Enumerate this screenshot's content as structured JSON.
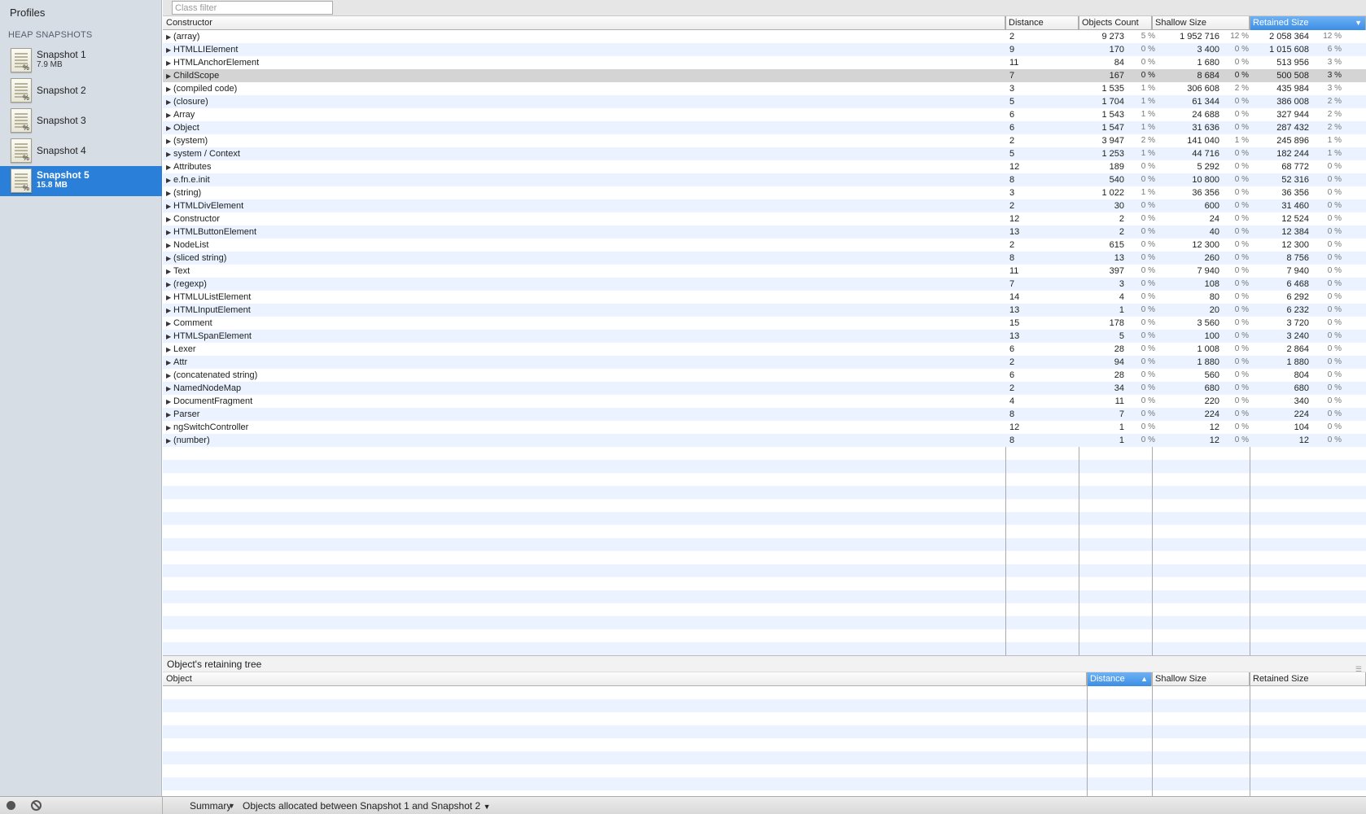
{
  "sidebar": {
    "title": "Profiles",
    "section": "HEAP SNAPSHOTS",
    "snapshots": [
      {
        "name": "Snapshot 1",
        "size": "7.9 MB"
      },
      {
        "name": "Snapshot 2",
        "size": ""
      },
      {
        "name": "Snapshot 3",
        "size": ""
      },
      {
        "name": "Snapshot 4",
        "size": ""
      },
      {
        "name": "Snapshot 5",
        "size": "15.8 MB",
        "selected": true
      }
    ]
  },
  "filter": {
    "placeholder": "Class filter"
  },
  "columns": {
    "constructor": "Constructor",
    "distance": "Distance",
    "objects_count": "Objects Count",
    "shallow_size": "Shallow Size",
    "retained_size": "Retained Size",
    "sort_arrow": "▼"
  },
  "rows": [
    {
      "name": "(array)",
      "distance": "2",
      "count": "9 273",
      "count_pct": "5 %",
      "shallow": "1 952 716",
      "shallow_pct": "12 %",
      "retained": "2 058 364",
      "retained_pct": "12 %"
    },
    {
      "name": "HTMLLIElement",
      "distance": "9",
      "count": "170",
      "count_pct": "0 %",
      "shallow": "3 400",
      "shallow_pct": "0 %",
      "retained": "1 015 608",
      "retained_pct": "6 %"
    },
    {
      "name": "HTMLAnchorElement",
      "distance": "11",
      "count": "84",
      "count_pct": "0 %",
      "shallow": "1 680",
      "shallow_pct": "0 %",
      "retained": "513 956",
      "retained_pct": "3 %"
    },
    {
      "name": "ChildScope",
      "distance": "7",
      "count": "167",
      "count_pct": "0 %",
      "shallow": "8 684",
      "shallow_pct": "0 %",
      "retained": "500 508",
      "retained_pct": "3 %",
      "highlight": true
    },
    {
      "name": "(compiled code)",
      "distance": "3",
      "count": "1 535",
      "count_pct": "1 %",
      "shallow": "306 608",
      "shallow_pct": "2 %",
      "retained": "435 984",
      "retained_pct": "3 %"
    },
    {
      "name": "(closure)",
      "distance": "5",
      "count": "1 704",
      "count_pct": "1 %",
      "shallow": "61 344",
      "shallow_pct": "0 %",
      "retained": "386 008",
      "retained_pct": "2 %"
    },
    {
      "name": "Array",
      "distance": "6",
      "count": "1 543",
      "count_pct": "1 %",
      "shallow": "24 688",
      "shallow_pct": "0 %",
      "retained": "327 944",
      "retained_pct": "2 %"
    },
    {
      "name": "Object",
      "distance": "6",
      "count": "1 547",
      "count_pct": "1 %",
      "shallow": "31 636",
      "shallow_pct": "0 %",
      "retained": "287 432",
      "retained_pct": "2 %"
    },
    {
      "name": "(system)",
      "distance": "2",
      "count": "3 947",
      "count_pct": "2 %",
      "shallow": "141 040",
      "shallow_pct": "1 %",
      "retained": "245 896",
      "retained_pct": "1 %"
    },
    {
      "name": "system / Context",
      "distance": "5",
      "count": "1 253",
      "count_pct": "1 %",
      "shallow": "44 716",
      "shallow_pct": "0 %",
      "retained": "182 244",
      "retained_pct": "1 %"
    },
    {
      "name": "Attributes",
      "distance": "12",
      "count": "189",
      "count_pct": "0 %",
      "shallow": "5 292",
      "shallow_pct": "0 %",
      "retained": "68 772",
      "retained_pct": "0 %"
    },
    {
      "name": "e.fn.e.init",
      "distance": "8",
      "count": "540",
      "count_pct": "0 %",
      "shallow": "10 800",
      "shallow_pct": "0 %",
      "retained": "52 316",
      "retained_pct": "0 %"
    },
    {
      "name": "(string)",
      "distance": "3",
      "count": "1 022",
      "count_pct": "1 %",
      "shallow": "36 356",
      "shallow_pct": "0 %",
      "retained": "36 356",
      "retained_pct": "0 %"
    },
    {
      "name": "HTMLDivElement",
      "distance": "2",
      "count": "30",
      "count_pct": "0 %",
      "shallow": "600",
      "shallow_pct": "0 %",
      "retained": "31 460",
      "retained_pct": "0 %"
    },
    {
      "name": "Constructor",
      "distance": "12",
      "count": "2",
      "count_pct": "0 %",
      "shallow": "24",
      "shallow_pct": "0 %",
      "retained": "12 524",
      "retained_pct": "0 %"
    },
    {
      "name": "HTMLButtonElement",
      "distance": "13",
      "count": "2",
      "count_pct": "0 %",
      "shallow": "40",
      "shallow_pct": "0 %",
      "retained": "12 384",
      "retained_pct": "0 %"
    },
    {
      "name": "NodeList",
      "distance": "2",
      "count": "615",
      "count_pct": "0 %",
      "shallow": "12 300",
      "shallow_pct": "0 %",
      "retained": "12 300",
      "retained_pct": "0 %"
    },
    {
      "name": "(sliced string)",
      "distance": "8",
      "count": "13",
      "count_pct": "0 %",
      "shallow": "260",
      "shallow_pct": "0 %",
      "retained": "8 756",
      "retained_pct": "0 %"
    },
    {
      "name": "Text",
      "distance": "11",
      "count": "397",
      "count_pct": "0 %",
      "shallow": "7 940",
      "shallow_pct": "0 %",
      "retained": "7 940",
      "retained_pct": "0 %"
    },
    {
      "name": "(regexp)",
      "distance": "7",
      "count": "3",
      "count_pct": "0 %",
      "shallow": "108",
      "shallow_pct": "0 %",
      "retained": "6 468",
      "retained_pct": "0 %"
    },
    {
      "name": "HTMLUListElement",
      "distance": "14",
      "count": "4",
      "count_pct": "0 %",
      "shallow": "80",
      "shallow_pct": "0 %",
      "retained": "6 292",
      "retained_pct": "0 %"
    },
    {
      "name": "HTMLInputElement",
      "distance": "13",
      "count": "1",
      "count_pct": "0 %",
      "shallow": "20",
      "shallow_pct": "0 %",
      "retained": "6 232",
      "retained_pct": "0 %"
    },
    {
      "name": "Comment",
      "distance": "15",
      "count": "178",
      "count_pct": "0 %",
      "shallow": "3 560",
      "shallow_pct": "0 %",
      "retained": "3 720",
      "retained_pct": "0 %"
    },
    {
      "name": "HTMLSpanElement",
      "distance": "13",
      "count": "5",
      "count_pct": "0 %",
      "shallow": "100",
      "shallow_pct": "0 %",
      "retained": "3 240",
      "retained_pct": "0 %"
    },
    {
      "name": "Lexer",
      "distance": "6",
      "count": "28",
      "count_pct": "0 %",
      "shallow": "1 008",
      "shallow_pct": "0 %",
      "retained": "2 864",
      "retained_pct": "0 %"
    },
    {
      "name": "Attr",
      "distance": "2",
      "count": "94",
      "count_pct": "0 %",
      "shallow": "1 880",
      "shallow_pct": "0 %",
      "retained": "1 880",
      "retained_pct": "0 %"
    },
    {
      "name": "(concatenated string)",
      "distance": "6",
      "count": "28",
      "count_pct": "0 %",
      "shallow": "560",
      "shallow_pct": "0 %",
      "retained": "804",
      "retained_pct": "0 %"
    },
    {
      "name": "NamedNodeMap",
      "distance": "2",
      "count": "34",
      "count_pct": "0 %",
      "shallow": "680",
      "shallow_pct": "0 %",
      "retained": "680",
      "retained_pct": "0 %"
    },
    {
      "name": "DocumentFragment",
      "distance": "4",
      "count": "11",
      "count_pct": "0 %",
      "shallow": "220",
      "shallow_pct": "0 %",
      "retained": "340",
      "retained_pct": "0 %"
    },
    {
      "name": "Parser",
      "distance": "8",
      "count": "7",
      "count_pct": "0 %",
      "shallow": "224",
      "shallow_pct": "0 %",
      "retained": "224",
      "retained_pct": "0 %"
    },
    {
      "name": "ngSwitchController",
      "distance": "12",
      "count": "1",
      "count_pct": "0 %",
      "shallow": "12",
      "shallow_pct": "0 %",
      "retained": "104",
      "retained_pct": "0 %"
    },
    {
      "name": "(number)",
      "distance": "8",
      "count": "1",
      "count_pct": "0 %",
      "shallow": "12",
      "shallow_pct": "0 %",
      "retained": "12",
      "retained_pct": "0 %"
    }
  ],
  "retaining": {
    "title": "Object's retaining tree",
    "columns": {
      "object": "Object",
      "distance": "Distance",
      "shallow_size": "Shallow Size",
      "retained_size": "Retained Size",
      "sort_arrow": "▲"
    }
  },
  "statusbar": {
    "view": "Summary",
    "range": "Objects allocated between Snapshot 1 and Snapshot 2",
    "dropdown_arrow": "▼"
  },
  "colors": {
    "selection": "#2a7fd8",
    "sorted_header": "#3b8ee5",
    "row_alt": "#eaf3ff",
    "sidebar_bg": "#d6dde5"
  }
}
